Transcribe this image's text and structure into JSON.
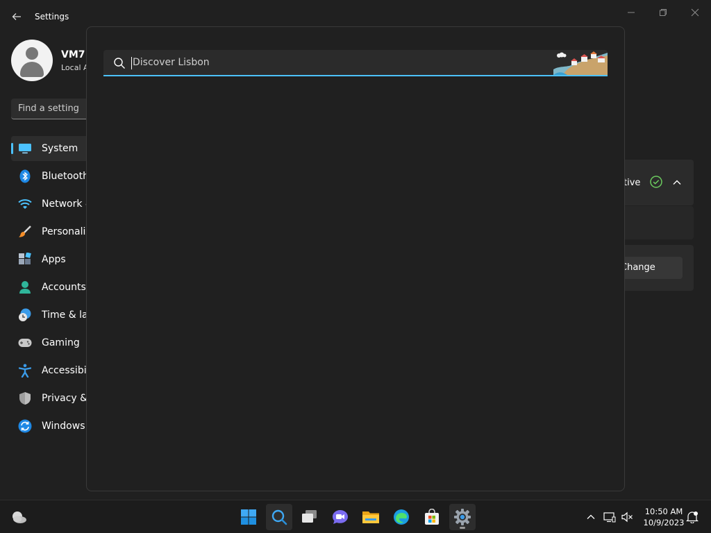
{
  "window": {
    "title": "Settings"
  },
  "profile": {
    "name": "VM7",
    "account_type": "Local A"
  },
  "find_setting": {
    "placeholder": "Find a setting"
  },
  "nav": {
    "items": [
      {
        "label": "System",
        "icon": "monitor-icon",
        "selected": true
      },
      {
        "label": "Bluetooth",
        "icon": "bluetooth-icon"
      },
      {
        "label": "Network &",
        "icon": "wifi-icon"
      },
      {
        "label": "Personaliz",
        "icon": "brush-icon"
      },
      {
        "label": "Apps",
        "icon": "apps-icon"
      },
      {
        "label": "Accounts",
        "icon": "person-icon"
      },
      {
        "label": "Time & lan",
        "icon": "clock-globe-icon"
      },
      {
        "label": "Gaming",
        "icon": "gamepad-icon"
      },
      {
        "label": "Accessibili",
        "icon": "accessibility-icon"
      },
      {
        "label": "Privacy & s",
        "icon": "shield-icon"
      },
      {
        "label": "Windows U",
        "icon": "update-icon"
      }
    ]
  },
  "content": {
    "status_text": "tive",
    "change_label": "Change"
  },
  "search": {
    "placeholder": "Discover Lisbon",
    "value": ""
  },
  "taskbar": {
    "apps": [
      "start-icon",
      "search-icon",
      "task-view-icon",
      "chat-icon",
      "file-explorer-icon",
      "edge-icon",
      "store-icon",
      "settings-icon"
    ]
  },
  "clock": {
    "time": "10:50 AM",
    "date": "10/9/2023"
  },
  "colors": {
    "accent": "#4cc2ff",
    "background": "#202020",
    "taskbar": "#1c1c1c"
  }
}
